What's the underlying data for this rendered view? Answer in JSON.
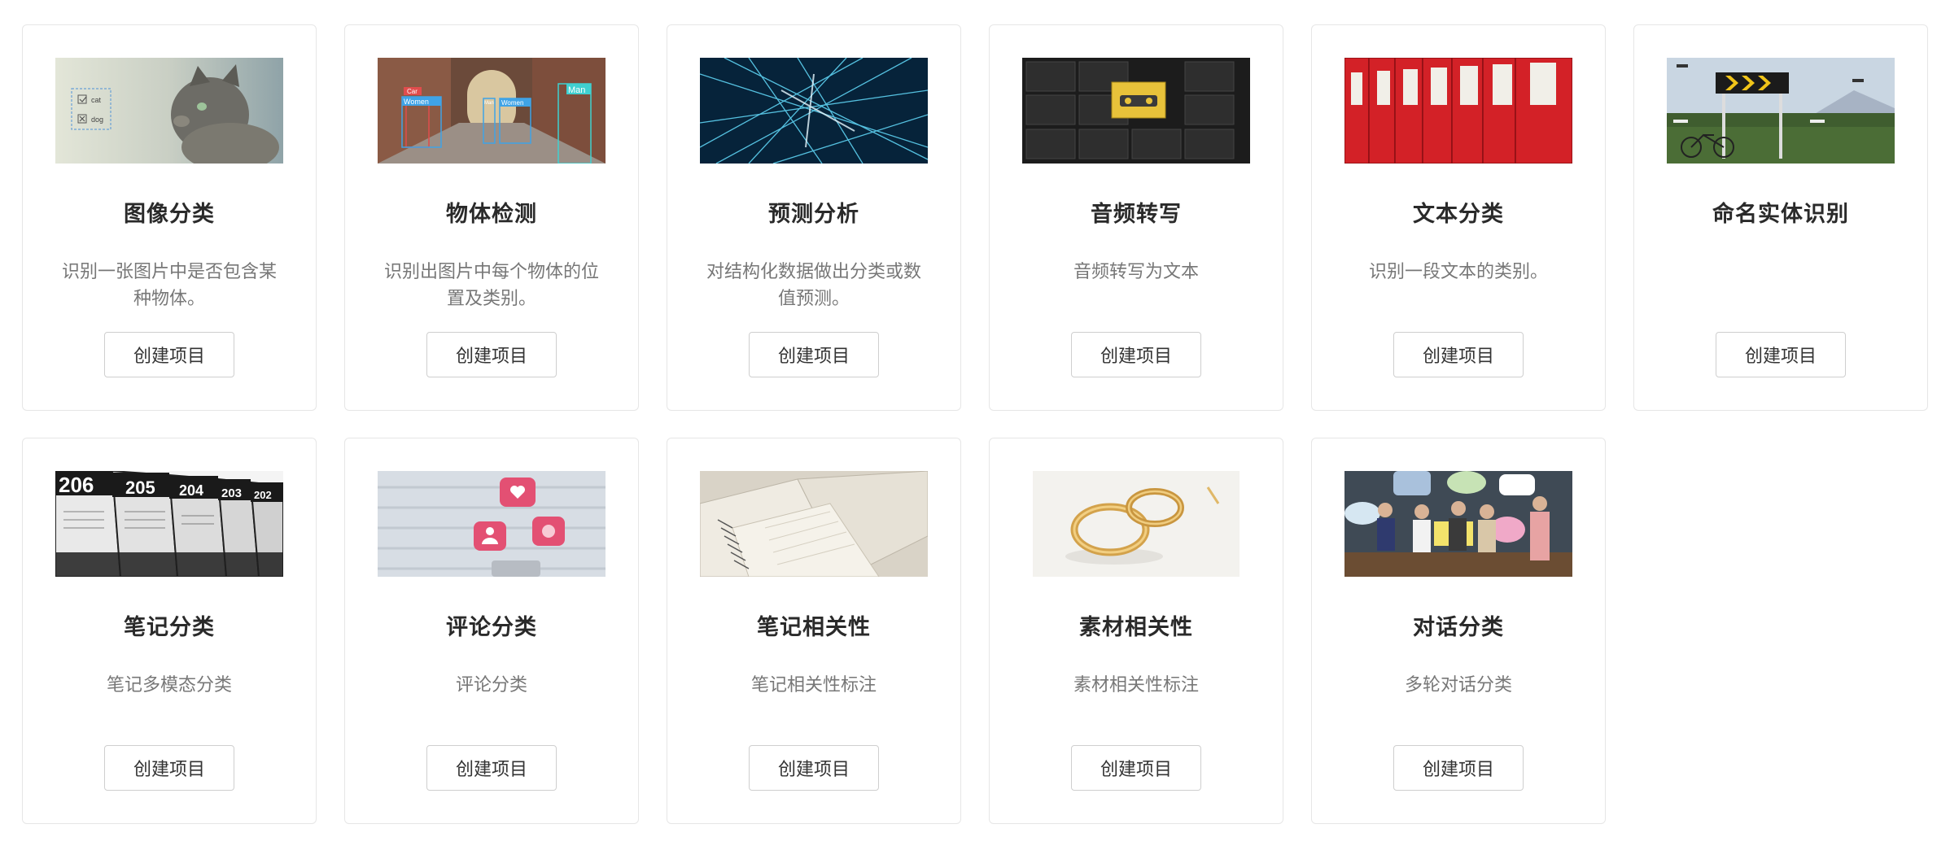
{
  "cards": [
    {
      "title": "图像分类",
      "desc": "识别一张图片中是否包含某种物体。",
      "button": "创建项目",
      "image": "cat-classification-image",
      "overlay": [
        "cat",
        "dog"
      ]
    },
    {
      "title": "物体检测",
      "desc": "识别出图片中每个物体的位置及类别。",
      "button": "创建项目",
      "image": "street-detection-image",
      "overlay": [
        "Car",
        "Women",
        "Man",
        "Women",
        "Man"
      ]
    },
    {
      "title": "预测分析",
      "desc": "对结构化数据做出分类或数值预测。",
      "button": "创建项目",
      "image": "network-lines-image"
    },
    {
      "title": "音频转写",
      "desc": "音频转写为文本",
      "button": "创建项目",
      "image": "cassette-tapes-image"
    },
    {
      "title": "文本分类",
      "desc": "识别一段文本的类别。",
      "button": "创建项目",
      "image": "red-binders-image"
    },
    {
      "title": "命名实体识别",
      "desc": "",
      "button": "创建项目",
      "image": "road-sign-field-image"
    },
    {
      "title": "笔记分类",
      "desc": "笔记多模态分类",
      "button": "创建项目",
      "image": "numbered-cards-image",
      "overlay": [
        "206",
        "205",
        "204",
        "203",
        "202"
      ]
    },
    {
      "title": "评论分类",
      "desc": "评论分类",
      "button": "创建项目",
      "image": "social-reactions-image"
    },
    {
      "title": "笔记相关性",
      "desc": "笔记相关性标注",
      "button": "创建项目",
      "image": "notebooks-image"
    },
    {
      "title": "素材相关性",
      "desc": "素材相关性标注",
      "button": "创建项目",
      "image": "gold-rings-image"
    },
    {
      "title": "对话分类",
      "desc": "多轮对话分类",
      "button": "创建项目",
      "image": "people-speech-bubbles-image"
    }
  ]
}
